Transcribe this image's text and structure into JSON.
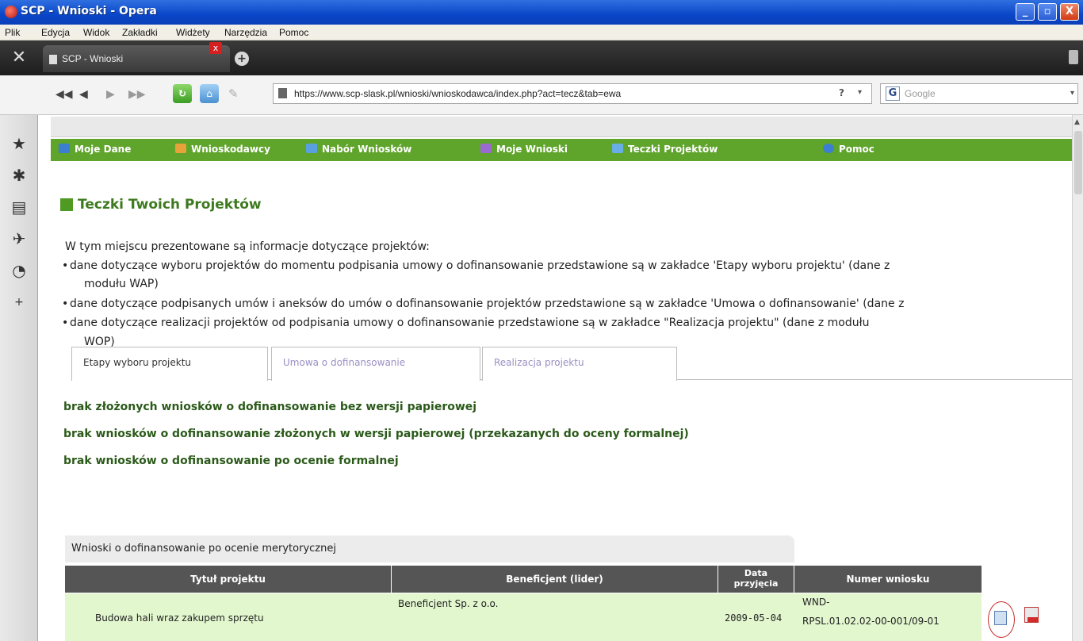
{
  "window": {
    "title": "SCP - Wnioski - Opera",
    "controls": [
      "_",
      "▫",
      "X"
    ]
  },
  "menu": [
    "Plik",
    "Edycja",
    "Widok",
    "Zakładki",
    "Widżety",
    "Narzędzia",
    "Pomoc"
  ],
  "browser_tab": {
    "label": "SCP - Wnioski",
    "close": "x",
    "new_tab": "+"
  },
  "address": {
    "url": "https://www.scp-slask.pl/wnioski/wnioskodawca/index.php?act=tecz&tab=ewa",
    "help": "?",
    "dropdown": "▾"
  },
  "search": {
    "engine_letter": "G",
    "placeholder": "Google",
    "dropdown": "▾"
  },
  "site_nav": [
    {
      "label": "Moje Dane",
      "color": "#3c7fd1"
    },
    {
      "label": "Wnioskodawcy",
      "color": "#e8a23a"
    },
    {
      "label": "Nabór Wniosków",
      "color": "#5aa0e0"
    },
    {
      "label": "Moje Wnioski",
      "color": "#9b6ad0"
    },
    {
      "label": "Teczki Projektów",
      "color": "#6aaee8"
    },
    {
      "label": "Pomoc",
      "color": "#3c7fd1"
    }
  ],
  "page": {
    "title": "Teczki Twoich Projektów",
    "intro": "W tym miejscu prezentowane są informacje dotyczące projektów:",
    "bullets": [
      "dane dotyczące wyboru projektów do momentu podpisania umowy o dofinansowanie przedstawione są w zakładce 'Etapy wyboru projektu' (dane z",
      "dane dotyczące podpisanych umów i aneksów do umów o dofinansowanie projektów przedstawione są w zakładce 'Umowa o dofinansowanie' (dane z",
      "dane dotyczące realizacji projektów od podpisania umowy o dofinansowanie przedstawione są w zakładce \"Realizacja projektu\" (dane z modułu"
    ],
    "bullet_continuations": [
      "modułu WAP)",
      "WOP)"
    ],
    "tabs": [
      {
        "label": "Etapy wyboru projektu",
        "active": true
      },
      {
        "label": "Umowa o dofinansowanie",
        "active": false
      },
      {
        "label": "Realizacja projektu",
        "active": false
      }
    ],
    "messages": [
      "brak złożonych wniosków o dofinansowanie bez wersji papierowej",
      "brak wniosków o dofinansowanie złożonych w wersji papierowej (przekazanych do oceny formalnej)",
      "brak wniosków o dofinansowanie po ocenie formalnej"
    ],
    "table": {
      "caption": "Wnioski o dofinansowanie po ocenie merytorycznej",
      "headers": [
        "Tytuł projektu",
        "Beneficjent (lider)",
        "Data przyjęcia",
        "Numer wniosku"
      ],
      "header_date_lines": [
        "Data",
        "przyjęcia"
      ],
      "rows": [
        {
          "title": "Budowa hali wraz zakupem sprzętu",
          "beneficiary": "Beneficjent Sp. z o.o.",
          "date": "2009-05-04",
          "number_line1": "WND-",
          "number_line2": "RPSL.01.02.02-00-001/09-01"
        }
      ]
    }
  },
  "colors": {
    "nav_green": "#5fa42b",
    "title_green": "#3d7a1e",
    "header_gray": "#555555",
    "row_green": "#e3f7cf",
    "titlebar_blue": "#0a46c8"
  }
}
